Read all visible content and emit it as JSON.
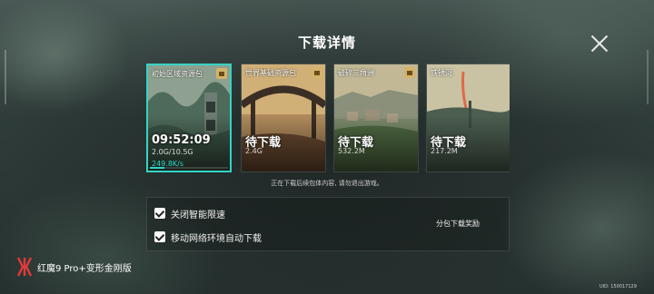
{
  "header": {
    "title": "下载详情"
  },
  "packs": [
    {
      "name": "初始区域资源包",
      "status": "09:52:09",
      "size": "2.0G/10.5G",
      "speed": "249.8K/s",
      "progress": 0.19,
      "active": true
    },
    {
      "name": "世界基础资源包",
      "status": "待下载",
      "size": "2.4G"
    },
    {
      "name": "破碎三角洲",
      "status": "待下载",
      "size": "532.2M"
    },
    {
      "name": "铁锈河",
      "status": "待下载",
      "size": "217.2M"
    }
  ],
  "note": "正在下载后续包体内容, 请勿退出游戏。",
  "options": {
    "limit_speed": {
      "label": "关闭智能限速",
      "checked": true
    },
    "auto_download": {
      "label": "移动网络环境自动下载",
      "checked": true
    },
    "reward_label": "分包下载奖励"
  },
  "branding": {
    "text": "红魔9 Pro+变形金刚版"
  },
  "uid": "UID: 150017129",
  "colors": {
    "accent": "#2fd6c7",
    "badge": "#d4b36a"
  }
}
